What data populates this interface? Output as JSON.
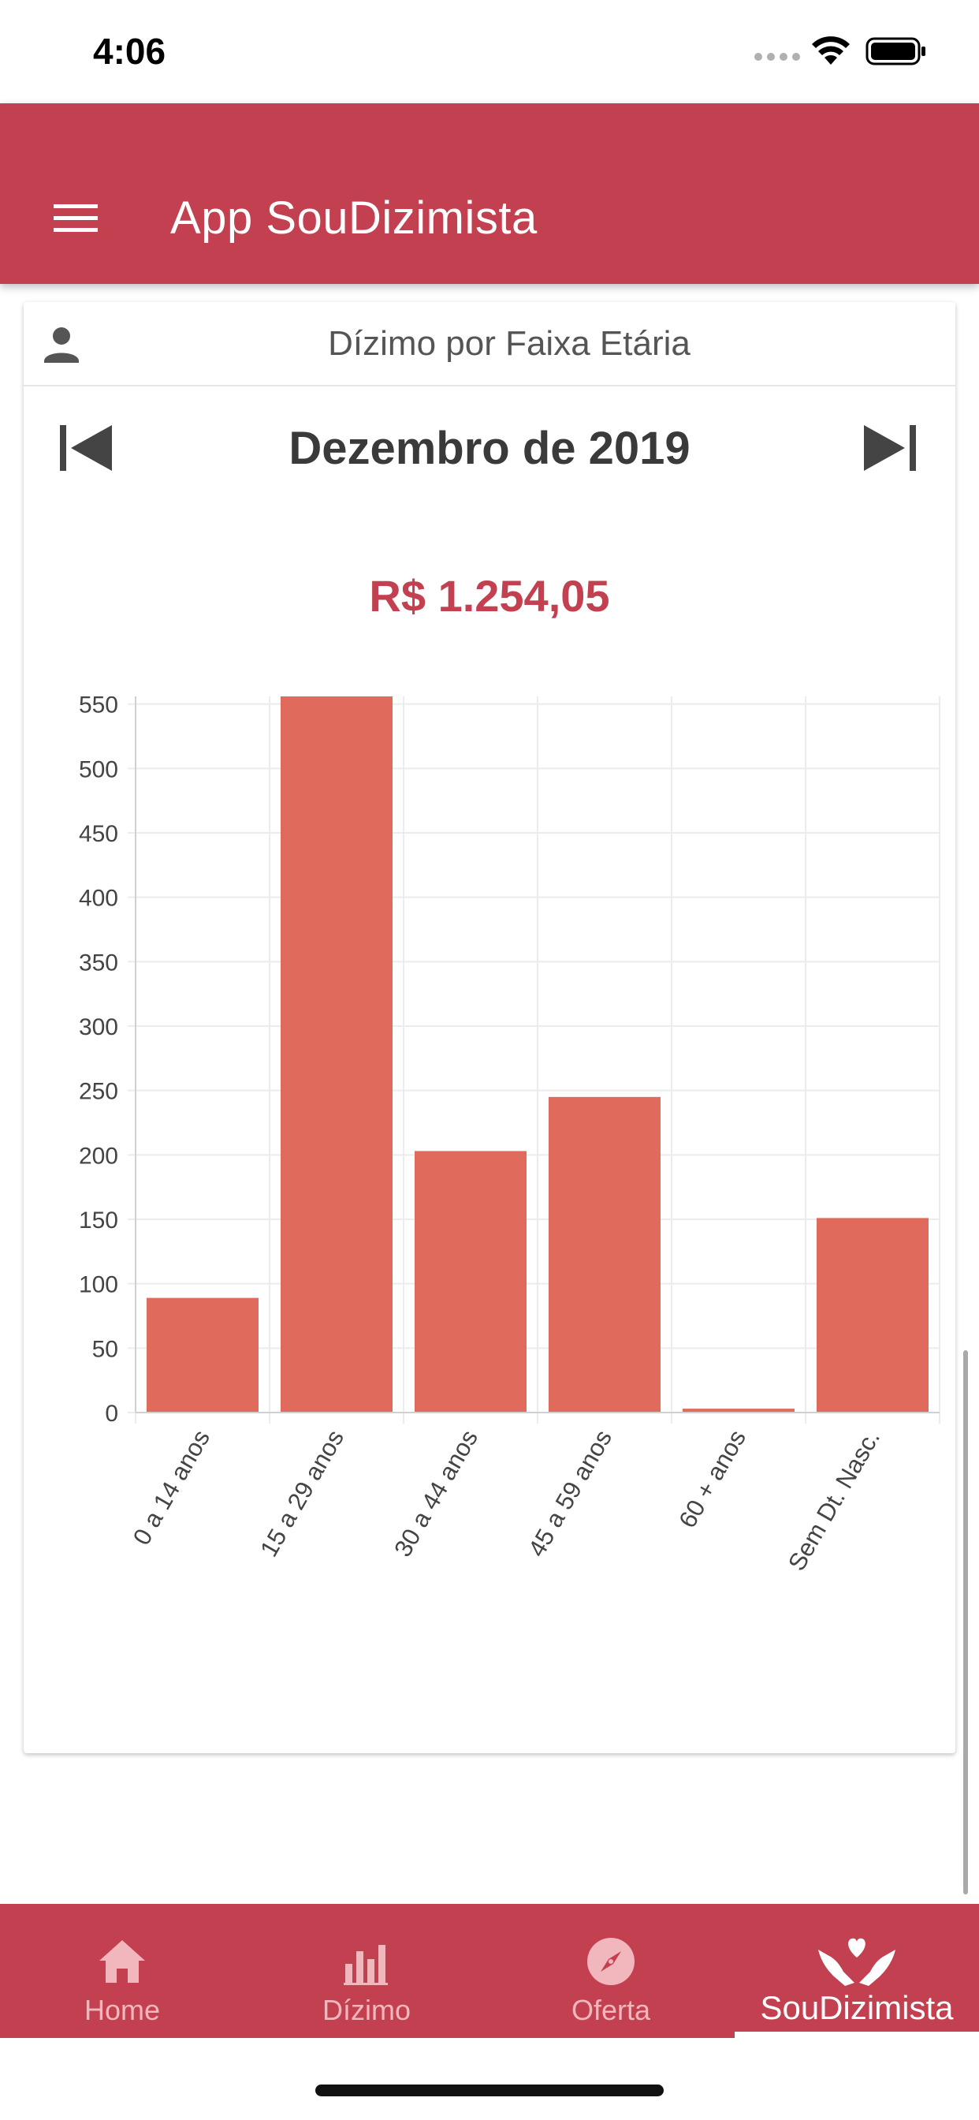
{
  "status_bar": {
    "time": "4:06"
  },
  "app_bar": {
    "title": "App SouDizimista",
    "accent": "#c2404f"
  },
  "card": {
    "title": "Dízimo por Faixa Etária",
    "month": "Dezembro de 2019",
    "total": "R$ 1.254,05"
  },
  "chart_data": {
    "type": "bar",
    "categories": [
      "0 a 14 anos",
      "15 a 29 anos",
      "30 a 44 anos",
      "45 a 59 anos",
      "60 + anos",
      "Sem Dt. Nasc."
    ],
    "values": [
      89,
      571,
      203,
      245,
      3,
      151
    ],
    "ylim": [
      0,
      600
    ],
    "yticks": [
      0,
      50,
      100,
      150,
      200,
      250,
      300,
      350,
      400,
      450,
      500,
      550,
      600
    ],
    "bar_color": "#e06b5c",
    "grid": true
  },
  "bottom_nav": {
    "items": [
      {
        "label": "Home",
        "icon": "home-icon"
      },
      {
        "label": "Dízimo",
        "icon": "bar-chart-icon"
      },
      {
        "label": "Oferta",
        "icon": "compass-icon"
      },
      {
        "label": "SouDizimista",
        "icon": "hands-heart-icon"
      }
    ],
    "active_index": 3
  }
}
